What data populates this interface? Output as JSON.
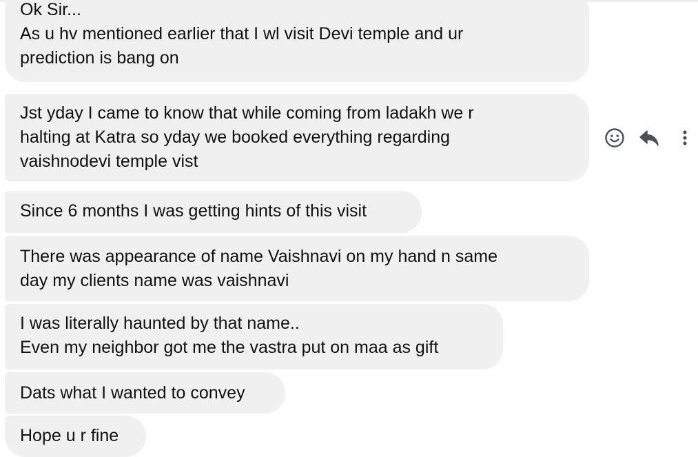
{
  "messages": [
    {
      "text": "Ok Sir...\nAs u hv mentioned earlier that I wl visit Devi temple and ur\nprediction is bang on"
    },
    {
      "text": "Jst yday I came to know that while coming from ladakh we r\nhalting at Katra so yday we booked everything regarding\nvaishnodevi temple vist"
    },
    {
      "text": "Since 6 months I was getting hints of this visit"
    },
    {
      "text": "There was appearance of name Vaishnavi on my hand n same\nday my clients name was vaishnavi"
    },
    {
      "text": "I was literally haunted by that name..\nEven my neighbor got me the vastra put on maa as gift"
    },
    {
      "text": "Dats what I wanted to convey"
    },
    {
      "text": "Hope u r fine"
    }
  ],
  "message_actions": {
    "icons": [
      "smiley-face-icon",
      "reply-arrow-icon",
      "vertical-dots-icon"
    ],
    "icon_color": "#4b4f56"
  },
  "colors": {
    "bubble_background": "#f0f0f0",
    "text": "#111111",
    "page_background": "#ffffff"
  }
}
